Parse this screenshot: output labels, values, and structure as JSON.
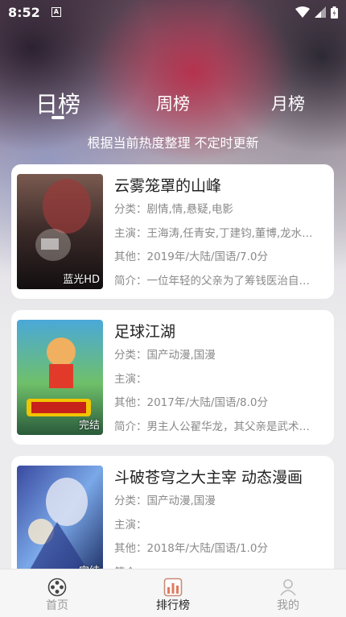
{
  "status_bar": {
    "time": "8:52",
    "notification_icon": "a-icon"
  },
  "tabs": [
    {
      "label": "日榜",
      "active": true
    },
    {
      "label": "周榜",
      "active": false
    },
    {
      "label": "月榜",
      "active": false
    }
  ],
  "subtitle": "根据当前热度整理 不定时更新",
  "items": [
    {
      "title": "云雾笼罩的山峰",
      "category": "分类：剧情,情,悬疑,电影",
      "cast": "主演：王海涛,任青安,丁建钧,董博,龙水…",
      "other": "其他：2019年/大陆/国语/7.0分",
      "summary": "简介：一位年轻的父亲为了筹钱医治自…",
      "badge": "蓝光HD"
    },
    {
      "title": "足球江湖",
      "category": "分类：国产动漫,国漫",
      "cast": "主演：",
      "other": "其他：2017年/大陆/国语/8.0分",
      "summary": "简介：男主人公翟华龙，其父亲是武术…",
      "badge": "完结"
    },
    {
      "title": "斗破苍穹之大主宰 动态漫画",
      "category": "分类：国产动漫,国漫",
      "cast": "主演：",
      "other": "其他：2018年/大陆/国语/1.0分",
      "summary": "简介：",
      "badge": "完结"
    }
  ],
  "bottom_nav": [
    {
      "label": "首页",
      "icon": "film-reel-icon",
      "active": false
    },
    {
      "label": "排行榜",
      "icon": "chart-icon",
      "active": true
    },
    {
      "label": "我的",
      "icon": "user-icon",
      "active": false
    }
  ]
}
